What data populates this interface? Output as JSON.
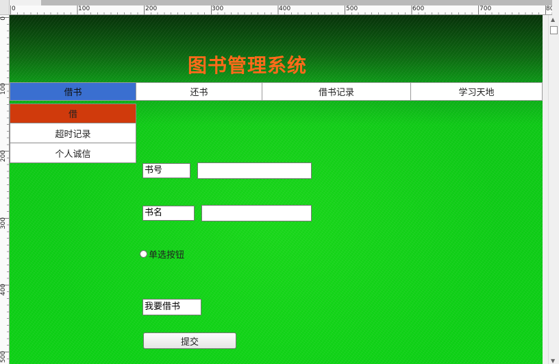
{
  "ruler": {
    "top_labels": [
      "0",
      "100",
      "200",
      "300",
      "400",
      "500",
      "600",
      "700",
      "80"
    ],
    "left_labels": [
      "0",
      "100",
      "200",
      "300",
      "400",
      "500"
    ]
  },
  "header": {
    "title": "图书管理系统"
  },
  "nav": {
    "items": [
      {
        "label": "借书",
        "active": true
      },
      {
        "label": "还书",
        "active": false
      },
      {
        "label": "借书记录",
        "active": false
      },
      {
        "label": "学习天地",
        "active": false
      }
    ]
  },
  "submenu": {
    "items": [
      {
        "label": "借",
        "active": true
      },
      {
        "label": "超时记录",
        "active": false
      },
      {
        "label": "个人诚信",
        "active": false
      }
    ]
  },
  "form": {
    "book_no_label": "书号",
    "book_no_value": "",
    "book_name_label": "书名",
    "book_name_value": "",
    "radio_label": "单选按钮",
    "borrow_label": "我要借书",
    "submit_label": "提交"
  },
  "colors": {
    "title": "#ff6a1a",
    "nav_active": "#3a6fd0",
    "submenu_active": "#d03a0c",
    "background": "#10cc18"
  }
}
